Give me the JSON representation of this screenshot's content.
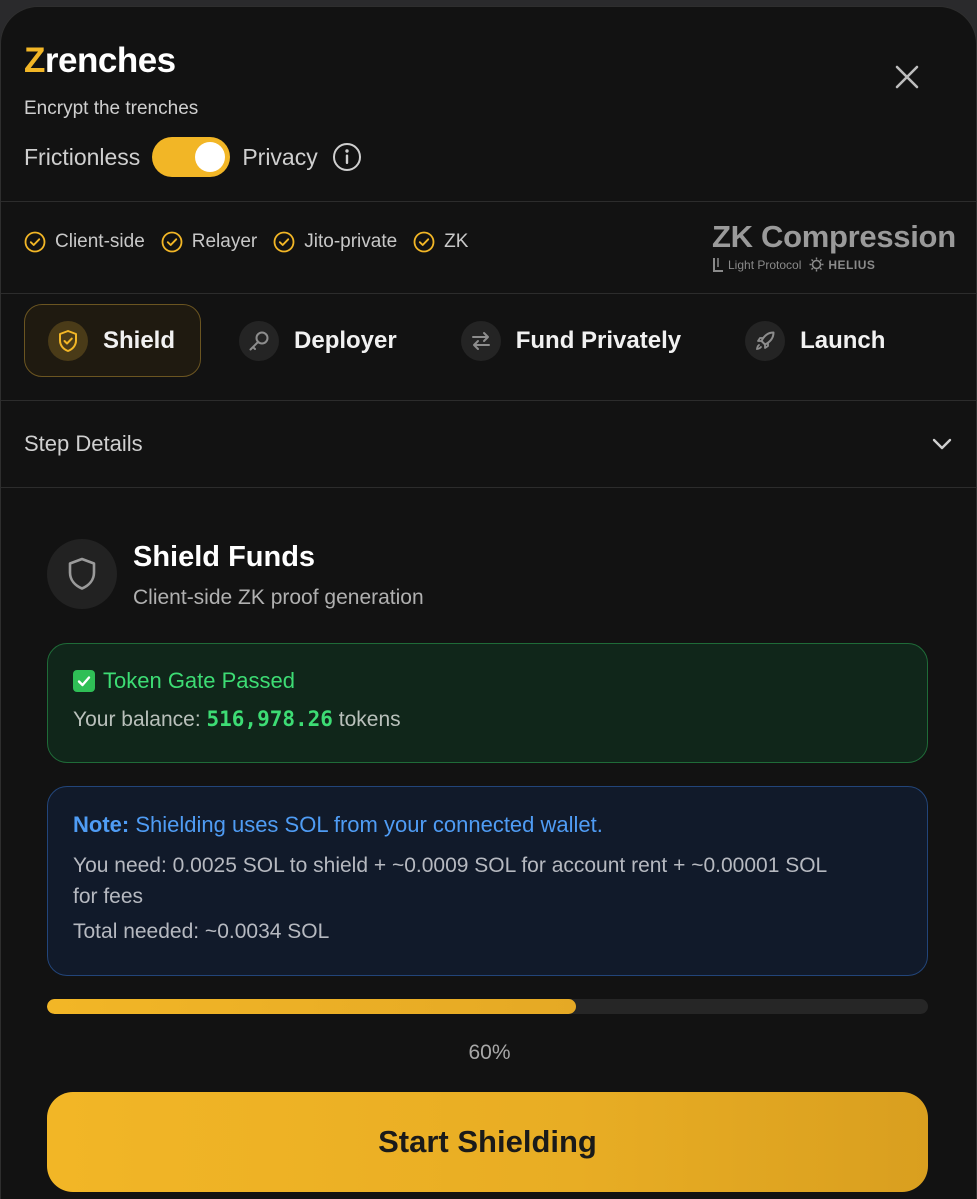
{
  "header": {
    "brand_initial": "Z",
    "brand_rest": "renches",
    "tagline": "Encrypt the trenches",
    "mode_left": "Frictionless",
    "mode_right": "Privacy",
    "toggle_on": true
  },
  "features": [
    {
      "label": "Client-side",
      "icon": "check-circle-icon"
    },
    {
      "label": "Relayer",
      "icon": "check-circle-icon"
    },
    {
      "label": "Jito-private",
      "icon": "check-circle-icon"
    },
    {
      "label": "ZK",
      "icon": "check-circle-icon"
    }
  ],
  "zk_brand": {
    "title": "ZK Compression",
    "partner1": "Light Protocol",
    "partner2": "HELIUS"
  },
  "tabs": [
    {
      "label": "Shield",
      "icon": "shield-icon",
      "active": true
    },
    {
      "label": "Deployer",
      "icon": "key-icon",
      "active": false
    },
    {
      "label": "Fund Privately",
      "icon": "swap-arrows-icon",
      "active": false
    },
    {
      "label": "Launch",
      "icon": "rocket-icon",
      "active": false
    }
  ],
  "step_details": {
    "label": "Step Details"
  },
  "shield": {
    "title": "Shield Funds",
    "subtitle": "Client-side ZK proof generation"
  },
  "gate": {
    "title": "Token Gate Passed",
    "balance_prefix": "Your balance: ",
    "balance_value": "516,978.26",
    "balance_suffix": " tokens"
  },
  "note": {
    "label": "Note:",
    "headline": " Shielding uses SOL from your connected wallet.",
    "detail": "You need: 0.0025 SOL to shield + ~0.0009 SOL for account rent + ~0.00001 SOL for fees",
    "total": "Total needed: ~0.0034 SOL"
  },
  "progress": {
    "percent": 60,
    "label": "60%"
  },
  "actions": {
    "start_label": "Start Shielding"
  },
  "colors": {
    "accent": "#f2b626",
    "success": "#3ddc74",
    "info": "#4f9cf4"
  }
}
